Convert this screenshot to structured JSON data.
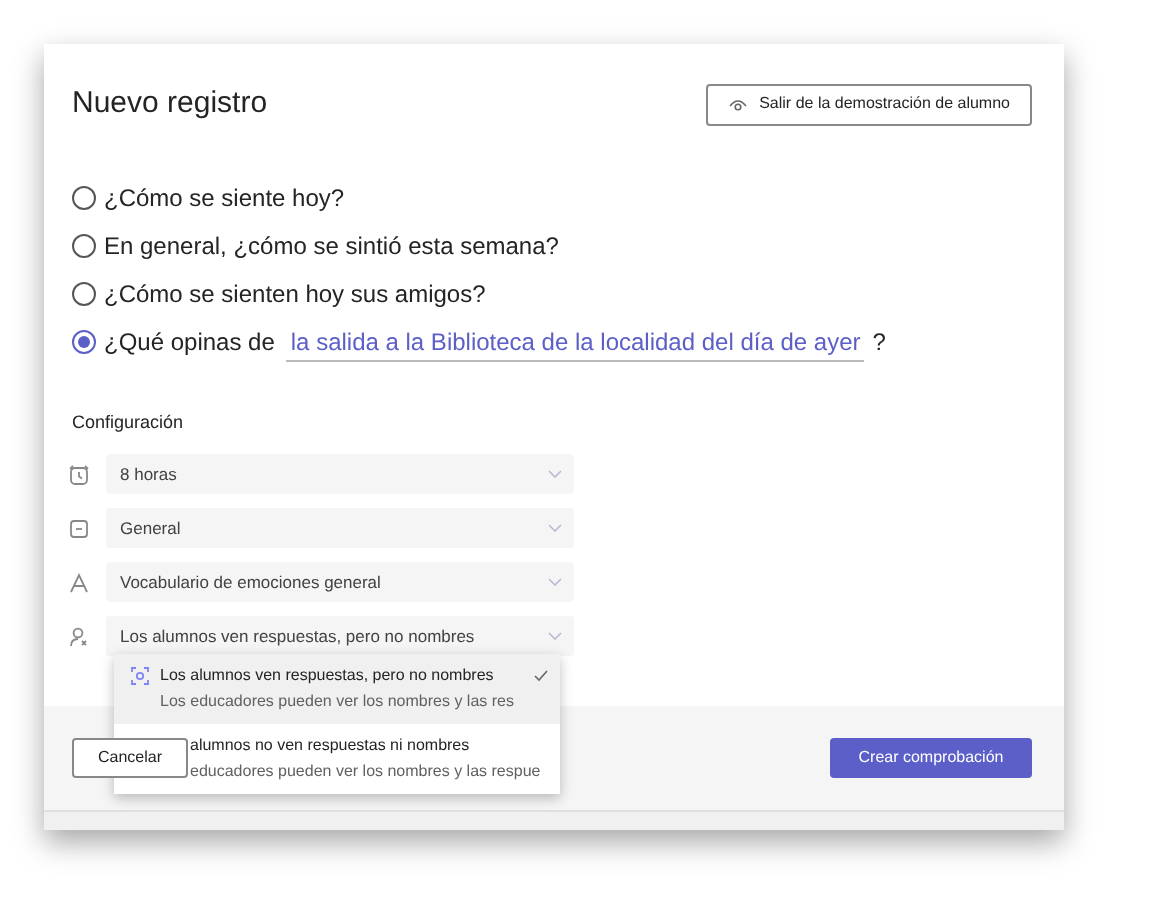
{
  "title": "Nuevo registro",
  "exit_button": {
    "label": "Salir de la demostración de alumno"
  },
  "questions": [
    {
      "label": "¿Cómo se siente hoy?",
      "selected": false
    },
    {
      "label": "En general, ¿cómo se sintió esta semana?",
      "selected": false
    },
    {
      "label": "¿Cómo se sienten hoy sus amigos?",
      "selected": false
    },
    {
      "label": "¿Qué opinas de",
      "field_value": "la salida a la Biblioteca de la localidad del día de ayer",
      "suffix": "?",
      "selected": true
    }
  ],
  "settings": {
    "heading": "Configuración",
    "dropdowns": [
      {
        "kind": "clock",
        "value": "8 horas"
      },
      {
        "kind": "calendar",
        "value": "General"
      },
      {
        "kind": "letter",
        "value": "Vocabulario de emociones general"
      },
      {
        "kind": "person",
        "value": "Los alumnos ven respuestas, pero no nombres"
      }
    ]
  },
  "privacy_menu": [
    {
      "title": "Los alumnos ven respuestas, pero no nombres",
      "description": "Los educadores pueden ver los nombres y las res",
      "selected": true
    },
    {
      "title": "alumnos no ven respuestas ni nombres",
      "description": "educadores pueden ver los nombres y las respue",
      "selected": false
    }
  ],
  "footer": {
    "cancel": "Cancelar",
    "create": "Crear comprobación"
  }
}
